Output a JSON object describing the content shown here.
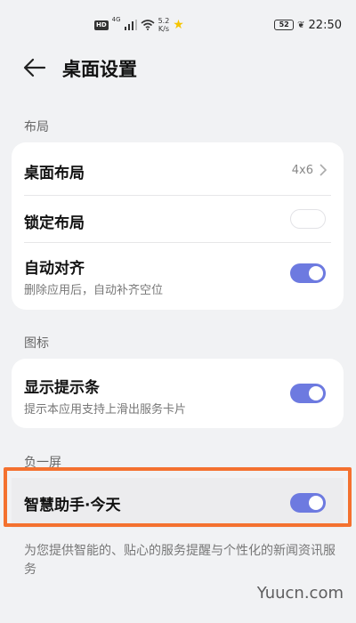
{
  "status_bar": {
    "hd": "HD",
    "network": "4G",
    "speed_value": "5.2",
    "speed_unit": "K/s",
    "battery": "52",
    "time": "22:50"
  },
  "header": {
    "title": "桌面设置"
  },
  "sections": {
    "layout": {
      "label": "布局",
      "rows": [
        {
          "title": "桌面布局",
          "value": "4x6"
        },
        {
          "title": "锁定布局",
          "toggle": false
        },
        {
          "title": "自动对齐",
          "subtitle": "删除应用后，自动补齐空位",
          "toggle": true
        }
      ]
    },
    "icons": {
      "label": "图标",
      "rows": [
        {
          "title": "显示提示条",
          "subtitle": "提示本应用支持上滑出服务卡片",
          "toggle": true
        }
      ]
    },
    "minus_one": {
      "label": "负一屏",
      "rows": [
        {
          "title": "智慧助手·今天",
          "toggle": true
        }
      ],
      "description": "为您提供智能的、贴心的服务提醒与个性化的新闻资讯服务"
    }
  },
  "watermark": "Yuucn.com",
  "colors": {
    "accent": "#6d7ae0",
    "highlight": "#f4712f",
    "background": "#f1f2f4"
  }
}
